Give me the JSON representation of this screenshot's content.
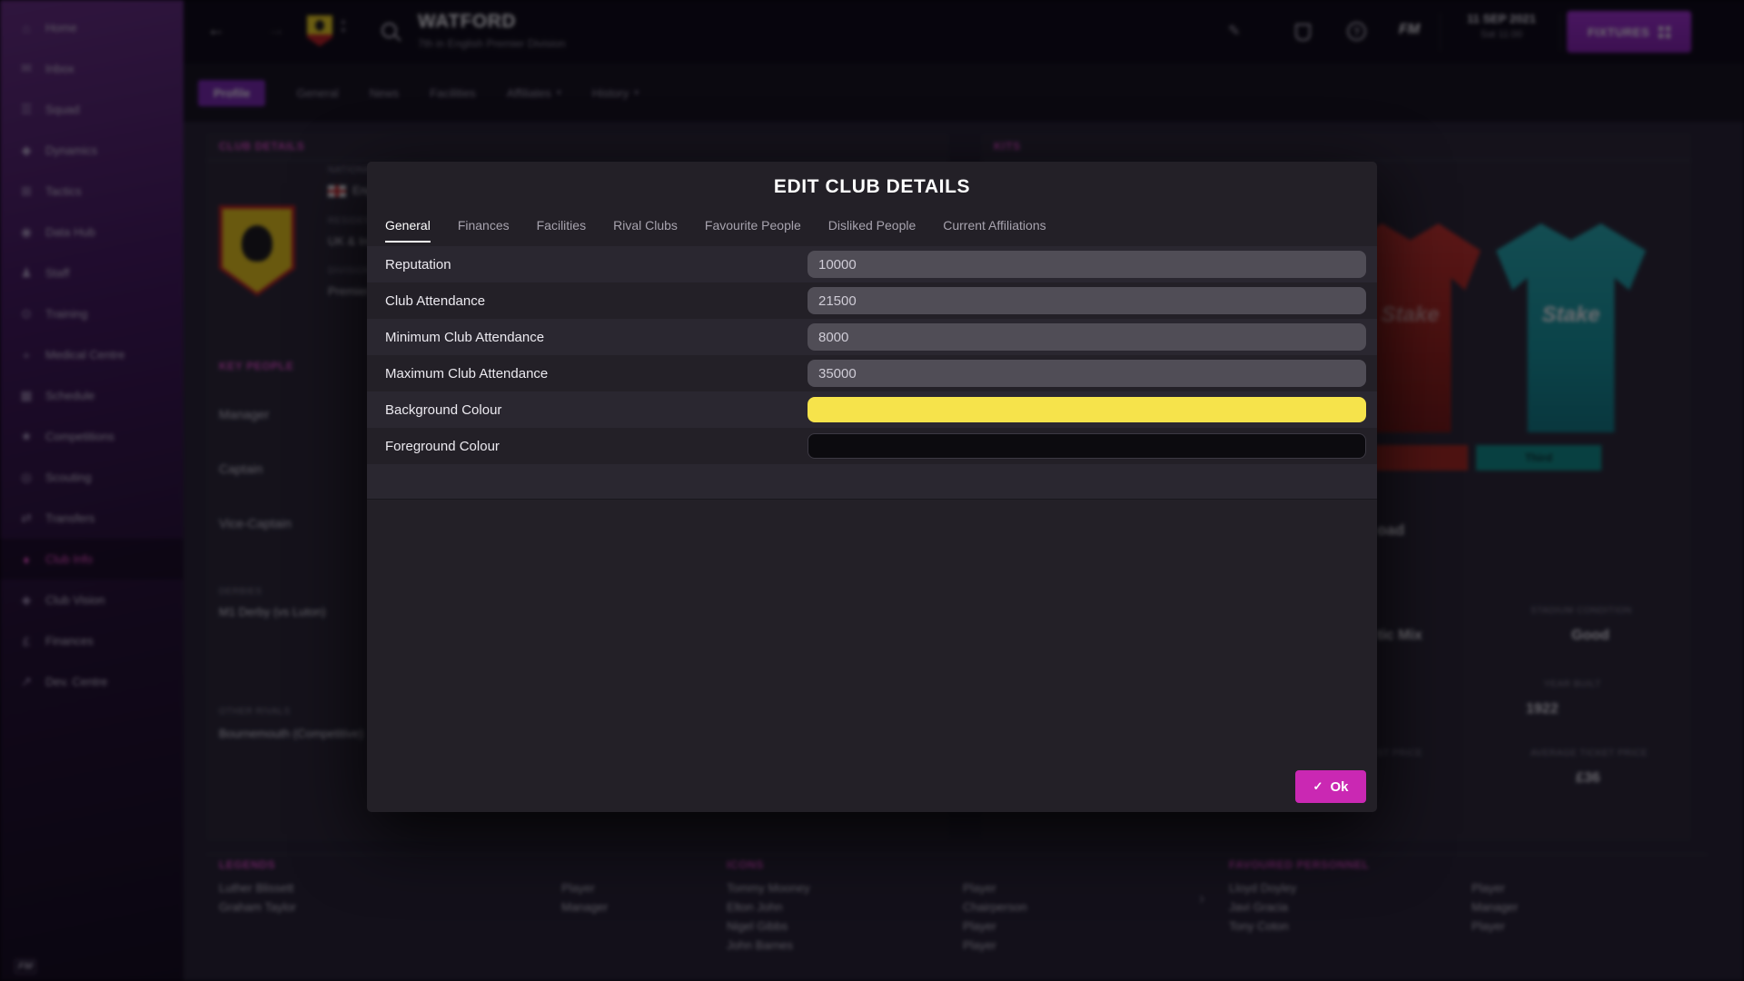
{
  "icons": {
    "home": "⌂",
    "inbox": "✉",
    "squad": "☰",
    "dynamics": "◆",
    "tactics": "⊞",
    "data_hub": "◉",
    "staff": "♟",
    "training": "⊙",
    "medical": "+",
    "schedule": "▦",
    "competitions": "★",
    "scouting": "◎",
    "transfers": "⇄",
    "club_info": "♦",
    "club_vision": "◈",
    "finances": "£",
    "dev_centre": "↗",
    "back": "←",
    "forward": "→",
    "sort_up": "▲",
    "sort_down": "▼",
    "pencil": "✎",
    "help": "?",
    "dropdown": "▾",
    "chevron_right": "›",
    "check": "✓",
    "fm": "FM"
  },
  "sidebar": {
    "items": [
      {
        "label": "Home"
      },
      {
        "label": "Inbox"
      },
      {
        "label": "Squad"
      },
      {
        "label": "Dynamics"
      },
      {
        "label": "Tactics"
      },
      {
        "label": "Data Hub"
      },
      {
        "label": "Staff"
      },
      {
        "label": "Training"
      },
      {
        "label": "Medical Centre"
      },
      {
        "label": "Schedule"
      },
      {
        "label": "Competitions"
      },
      {
        "label": "Scouting"
      },
      {
        "label": "Transfers"
      },
      {
        "label": "Club Info",
        "active": true
      },
      {
        "label": "Club Vision"
      },
      {
        "label": "Finances"
      },
      {
        "label": "Dev. Centre"
      }
    ]
  },
  "topbar": {
    "club_name": "WATFORD",
    "club_subtitle": "7th in English Premier Division",
    "date": "11 SEP 2021",
    "time": "Sat 11:00",
    "fixtures_label": "FIXTURES"
  },
  "page_tabs": {
    "tabs": [
      {
        "label": "Profile",
        "selected": true
      },
      {
        "label": "General"
      },
      {
        "label": "News"
      },
      {
        "label": "Facilities"
      },
      {
        "label": "Affiliates",
        "dropdown": true
      },
      {
        "label": "History",
        "dropdown": true
      }
    ]
  },
  "club_details": {
    "header": "CLUB DETAILS",
    "nationality_label": "NATIONALITY",
    "nationality_value": "England",
    "residency_label": "RESIDENCY",
    "residency_value": "UK & Ireland",
    "division_label": "DIVISION",
    "division_value": "Premier Division",
    "key_people_header": "KEY PEOPLE",
    "key_people": [
      "Manager",
      "Captain",
      "Vice-Captain"
    ],
    "derbies_label": "DERBIES",
    "derbies_value": "M1 Derby (vs Luton)",
    "other_rivals_label": "OTHER RIVALS",
    "other_rivals_value": "Bournemouth (Competitive)"
  },
  "kits": {
    "header": "KITS",
    "kit_brand": "Stake",
    "third_label": "Third",
    "stadium_name_fragment": "oad",
    "pitch_fragment": "tic Mix",
    "stadium_condition_label": "STADIUM CONDITION",
    "stadium_condition_value": "Good",
    "year_built_label": "YEAR BUILT",
    "year_built_value": "1922",
    "ticket_price_label_fragment": "ST PRICE",
    "avg_ticket_label": "AVERAGE TICKET PRICE",
    "avg_ticket_value": "£36"
  },
  "legends": {
    "header": "LEGENDS",
    "rows": [
      {
        "name": "Luther Blissett",
        "role": "Player"
      },
      {
        "name": "Graham Taylor",
        "role": "Manager"
      }
    ]
  },
  "icons_panel": {
    "header": "ICONS",
    "rows": [
      {
        "name": "Tommy Mooney",
        "role": "Player"
      },
      {
        "name": "Elton John",
        "role": "Chairperson"
      },
      {
        "name": "Nigel Gibbs",
        "role": "Player"
      },
      {
        "name": "John Barnes",
        "role": "Player"
      }
    ]
  },
  "favoured": {
    "header": "FAVOURED PERSONNEL",
    "rows": [
      {
        "name": "Lloyd Doyley",
        "role": "Player"
      },
      {
        "name": "Javi Gracia",
        "role": "Manager"
      },
      {
        "name": "Tony Coton",
        "role": "Player"
      }
    ]
  },
  "modal": {
    "title": "EDIT CLUB DETAILS",
    "tabs": [
      {
        "label": "General",
        "active": true
      },
      {
        "label": "Finances"
      },
      {
        "label": "Facilities"
      },
      {
        "label": "Rival Clubs"
      },
      {
        "label": "Favourite People"
      },
      {
        "label": "Disliked People"
      },
      {
        "label": "Current Affiliations"
      }
    ],
    "fields": [
      {
        "label": "Reputation",
        "value": "10000"
      },
      {
        "label": "Club Attendance",
        "value": "21500"
      },
      {
        "label": "Minimum Club Attendance",
        "value": "8000"
      },
      {
        "label": "Maximum Club Attendance",
        "value": "35000"
      },
      {
        "label": "Background Colour",
        "value": "#f6e34b"
      },
      {
        "label": "Foreground Colour",
        "value": "#0c0b0f"
      }
    ],
    "ok_label": "Ok"
  }
}
